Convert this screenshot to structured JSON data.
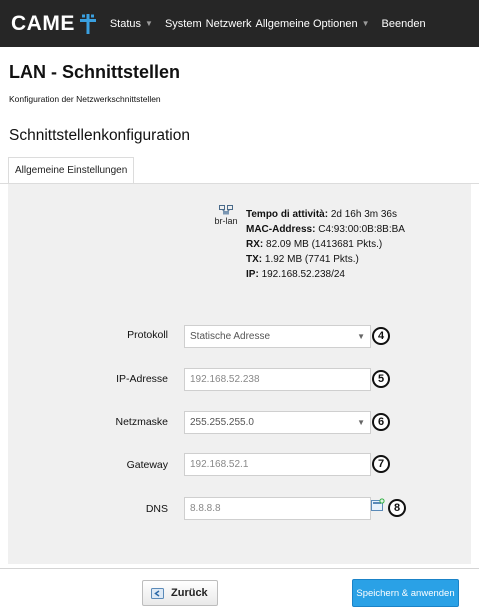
{
  "nav": {
    "logo_text": "CAME",
    "items": [
      {
        "label": "Status",
        "caret": true
      },
      {
        "label": "System",
        "caret": false
      },
      {
        "label": "Netzwerk",
        "caret": false
      },
      {
        "label": "Allgemeine Optionen",
        "caret": true
      },
      {
        "label": "Beenden",
        "caret": false
      }
    ]
  },
  "header": {
    "title": "LAN - Schnittstellen",
    "description": "Konfiguration der Netzwerkschnittstellen",
    "section_title": "Schnittstellenkonfiguration"
  },
  "tabs": [
    {
      "label": "Allgemeine Einstellungen",
      "active": true
    }
  ],
  "interface": {
    "name": "br-lan",
    "icon": "network-interface-icon",
    "uptime_label": "Tempo di attività:",
    "uptime_value": "2d 16h 3m 36s",
    "mac_label": "MAC-Address:",
    "mac_value": "C4:93:00:0B:8B:BA",
    "rx_label": "RX:",
    "rx_value": "82.09 MB (1413681 Pkts.)",
    "tx_label": "TX:",
    "tx_value": "1.92 MB (7741 Pkts.)",
    "ip_label": "IP:",
    "ip_value": "192.168.52.238/24"
  },
  "form": {
    "protocol": {
      "label": "Protokoll",
      "value": "Statische Adresse",
      "marker": "4"
    },
    "ip": {
      "label": "IP-Adresse",
      "value": "192.168.52.238",
      "marker": "5"
    },
    "netmask": {
      "label": "Netzmaske",
      "value": "255.255.255.0",
      "marker": "6"
    },
    "gateway": {
      "label": "Gateway",
      "value": "192.168.52.1",
      "marker": "7"
    },
    "dns": {
      "label": "DNS",
      "value": "8.8.8.8",
      "marker": "8"
    }
  },
  "footer": {
    "back_label": "Zurück",
    "save_label": "Speichern & anwenden"
  },
  "colors": {
    "navbar": "#262626",
    "logo_accent": "#3aa0e0",
    "panel": "#f0f0f0",
    "primary_button": "#2aa1e6"
  }
}
